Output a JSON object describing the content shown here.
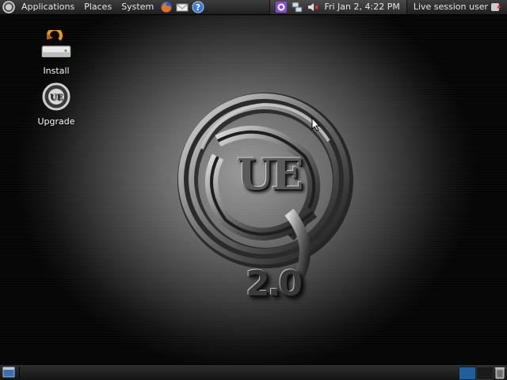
{
  "top_panel": {
    "menus": [
      "Applications",
      "Places",
      "System"
    ],
    "launchers": [
      "firefox-icon",
      "mail-icon",
      "help-icon"
    ],
    "clock": "Fri Jan  2,  4:22 PM",
    "session_label": "Live session user"
  },
  "desktop": {
    "icons": [
      {
        "label": "Install"
      },
      {
        "label": "Upgrade"
      }
    ],
    "wallpaper": {
      "logo_text": "UE",
      "version": "2.0"
    }
  },
  "colors": {
    "panel_bg": "#2a2a2a",
    "panel_text": "#e8e8e8",
    "workspace_active": "#1f5f9a"
  }
}
